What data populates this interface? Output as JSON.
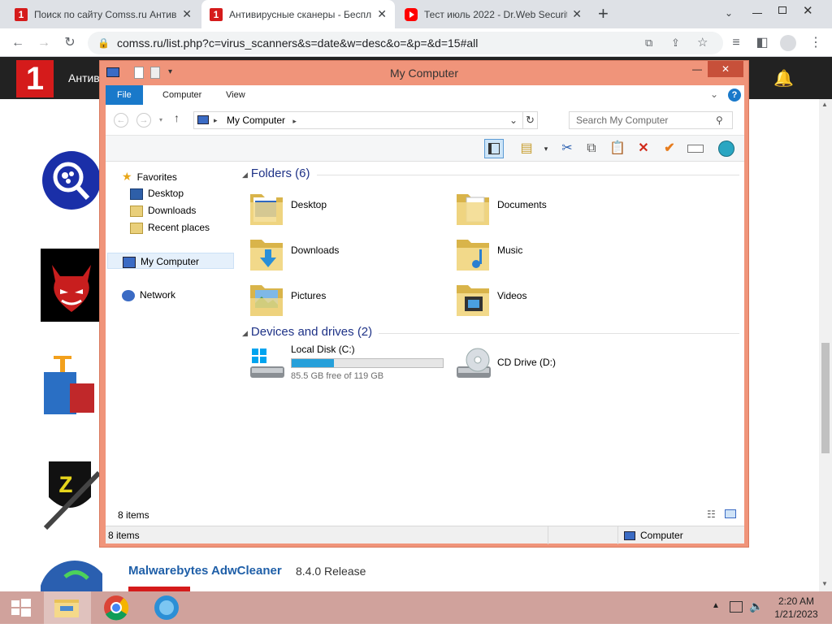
{
  "browser": {
    "tabs": [
      {
        "title": "Поиск по сайту Comss.ru Антив",
        "active": false
      },
      {
        "title": "Антивирусные сканеры - Беспл",
        "active": true
      },
      {
        "title": "Тест июль 2022 - Dr.Web Securit",
        "active": false
      }
    ],
    "new_tab_symbol": "+",
    "url": "comss.ru/list.php?c=virus_scanners&s=date&w=desc&o=&p=&d=15#all"
  },
  "site": {
    "logo_text": "1",
    "nav_text": "Антив",
    "program_title": "Malwarebytes AdwCleaner",
    "program_version": "8.4.0 Release"
  },
  "explorer": {
    "title": "My Computer",
    "ribbon_tabs": [
      "File",
      "Computer",
      "View"
    ],
    "breadcrumb": "My Computer",
    "search_placeholder": "Search My Computer",
    "nav": {
      "favorites": "Favorites",
      "desktop": "Desktop",
      "downloads": "Downloads",
      "recent": "Recent places",
      "computer": "My Computer",
      "network": "Network"
    },
    "groups": {
      "folders": "Folders (6)",
      "drives": "Devices and drives (2)"
    },
    "folders": [
      "Desktop",
      "Documents",
      "Downloads",
      "Music",
      "Pictures",
      "Videos"
    ],
    "drives": {
      "c_label": "Local Disk (C:)",
      "c_free": "85.5 GB free of 119 GB",
      "c_used_fraction": 0.28,
      "d_label": "CD Drive (D:)"
    },
    "item_count": "8 items",
    "status_count": "8 items",
    "status_location": "Computer"
  },
  "taskbar": {
    "time": "2:20 AM",
    "date": "1/21/2023"
  },
  "colors": {
    "window_frame": "#f0947a",
    "accent": "#1979ca",
    "taskbar": "#d0a29c"
  }
}
